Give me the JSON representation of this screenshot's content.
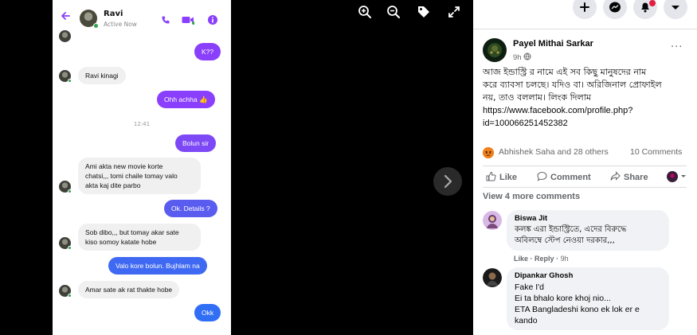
{
  "messenger": {
    "contact_name": "Ravi",
    "contact_status": "Active Now",
    "colors": {
      "accent": "#8a3ffc",
      "bubble_purple": "#8a3ffc",
      "bubble_blue": "#2f6ef5",
      "incoming_bg": "#f0f0f0"
    },
    "timestamp": "12:41",
    "messages": [
      {
        "dir": "out",
        "text": "K??"
      },
      {
        "dir": "in",
        "text": "Ravi kinagi"
      },
      {
        "dir": "out",
        "text": "Ohh achha 👍"
      },
      {
        "dir": "out",
        "text": "Bolun sir"
      },
      {
        "dir": "in",
        "lines": [
          "Ami akta new movie korte",
          "chatsi,,, tomi chaile tomay valo",
          "akta kaj dite parbo"
        ]
      },
      {
        "dir": "out",
        "text": "Ok. Details ?"
      },
      {
        "dir": "in",
        "lines": [
          "Sob dibo,,, but tomay akar sate",
          "kiso somoy katate hobe"
        ]
      },
      {
        "dir": "out",
        "text": "Valo kore bolun. Bujhlam na"
      },
      {
        "dir": "in",
        "text": "Amar sate ak rat thakte hobe"
      },
      {
        "dir": "out",
        "text": "Okk"
      }
    ]
  },
  "viewer": {
    "icons": [
      "zoom-in-icon",
      "zoom-out-icon",
      "tag-icon",
      "fullscreen-icon",
      "next-arrow-icon"
    ]
  },
  "facebook": {
    "topbar_icons": [
      "plus-icon",
      "messenger-icon",
      "notifications-icon",
      "account-menu-icon"
    ],
    "post": {
      "author": "Payel Mithai Sarkar",
      "time": "9h",
      "text_lines": [
        "আজ ইন্ডাস্ট্রি র নামে এই সব কিছু মানুষদের নাম",
        "করে ব্যাবসা চলছে। যদিও বা। অরিজিনাল প্রোফাইল",
        "নয়, তাও বললাম। লিংক দিলাম",
        "https://www.facebook.com/profile.php?",
        "id=100066251452382"
      ],
      "reactions_text": "Abhishek Saha and 28 others",
      "comments_count": "10 Comments",
      "actions": {
        "like": "Like",
        "comment": "Comment",
        "share": "Share"
      },
      "view_more": "View 4 more comments"
    },
    "comments": [
      {
        "name": "Biswa Jit",
        "lines": [
          "কলঙ্ক এরা ইন্ডাস্ট্রিতে, এদের বিরুদ্ধে",
          "অবিলম্বে স্টেপ নেওয়া দরকার,,,"
        ],
        "meta": {
          "like": "Like",
          "sep": "·",
          "reply": "Reply",
          "time": "9h"
        }
      },
      {
        "name": "Dipankar Ghosh",
        "lines": [
          "Fake I'd",
          "Ei ta bhalo kore khoj nio...",
          "ETA Bangladeshi kono ek lok er e",
          "kando"
        ]
      }
    ]
  }
}
